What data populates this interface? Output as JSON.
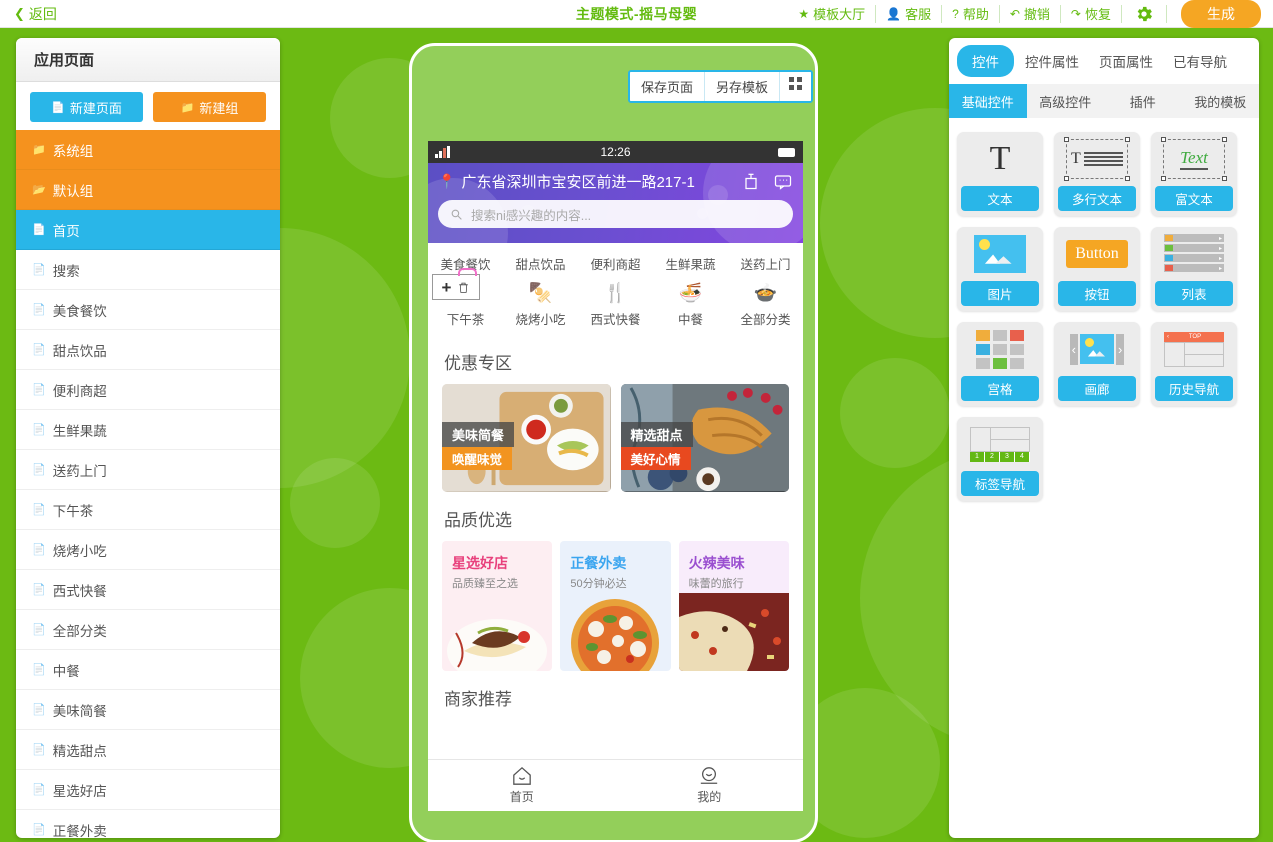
{
  "topbar": {
    "back_label": "返回",
    "title": "主题模式-摇马母婴",
    "items": [
      {
        "icon": "star-icon",
        "label": "模板大厅"
      },
      {
        "icon": "user-icon",
        "label": "客服"
      },
      {
        "icon": "question-icon",
        "label": "帮助"
      },
      {
        "icon": "undo-icon",
        "label": "撤销"
      },
      {
        "icon": "redo-icon",
        "label": "恢复"
      }
    ],
    "gear_icon": "gear-icon",
    "generate_label": "生成"
  },
  "pages_panel": {
    "header": "应用页面",
    "new_page_label": "新建页面",
    "new_group_label": "新建组",
    "rows": [
      {
        "label": "系统组",
        "type": "group",
        "icon": "folder-icon"
      },
      {
        "label": "默认组",
        "type": "group",
        "icon": "folder-open-icon"
      },
      {
        "label": "首页",
        "type": "page",
        "icon": "page-icon",
        "selected": true
      },
      {
        "label": "搜索",
        "type": "page",
        "icon": "page-icon"
      },
      {
        "label": "美食餐饮",
        "type": "page",
        "icon": "page-icon"
      },
      {
        "label": "甜点饮品",
        "type": "page",
        "icon": "page-icon"
      },
      {
        "label": "便利商超",
        "type": "page",
        "icon": "page-icon"
      },
      {
        "label": "生鲜果蔬",
        "type": "page",
        "icon": "page-icon"
      },
      {
        "label": "送药上门",
        "type": "page",
        "icon": "page-icon"
      },
      {
        "label": "下午茶",
        "type": "page",
        "icon": "page-icon"
      },
      {
        "label": "烧烤小吃",
        "type": "page",
        "icon": "page-icon"
      },
      {
        "label": "西式快餐",
        "type": "page",
        "icon": "page-icon"
      },
      {
        "label": "全部分类",
        "type": "page",
        "icon": "page-icon"
      },
      {
        "label": "中餐",
        "type": "page",
        "icon": "page-icon"
      },
      {
        "label": "美味简餐",
        "type": "page",
        "icon": "page-icon"
      },
      {
        "label": "精选甜点",
        "type": "page",
        "icon": "page-icon"
      },
      {
        "label": "星选好店",
        "type": "page",
        "icon": "page-icon"
      },
      {
        "label": "正餐外卖",
        "type": "page",
        "icon": "page-icon"
      }
    ]
  },
  "editor": {
    "save_page_label": "保存页面",
    "save_template_label": "另存模板",
    "qr_icon": "qr-code-icon"
  },
  "phone": {
    "status": {
      "time": "12:26",
      "signal_icon": "signal-icon",
      "battery_icon": "battery-icon"
    },
    "address": "广东省深圳市宝安区前进一路217-1",
    "banner_icons": [
      "scan-icon",
      "message-icon"
    ],
    "search_placeholder": "搜索ni感兴趣的内容...",
    "categories_row1": [
      {
        "label": "美食餐饮"
      },
      {
        "label": "甜点饮品"
      },
      {
        "label": "便利商超"
      },
      {
        "label": "生鲜果蔬"
      },
      {
        "label": "送药上门"
      }
    ],
    "categories_row2": [
      {
        "label": "下午茶",
        "icon": "",
        "editing": true
      },
      {
        "label": "烧烤小吃",
        "icon": "🍢"
      },
      {
        "label": "西式快餐",
        "icon": "🍴"
      },
      {
        "label": "中餐",
        "icon": "🍜"
      },
      {
        "label": "全部分类",
        "icon": "🍲"
      }
    ],
    "edit_overlay": {
      "add_icon": "plus-icon",
      "delete_icon": "trash-icon"
    },
    "promo_section_title": "优惠专区",
    "promos": [
      {
        "title": "美味简餐",
        "sub": "唤醒味觉",
        "sub_color": "#f29420"
      },
      {
        "title": "精选甜点",
        "sub": "美好心情",
        "sub_color": "#e8491f"
      }
    ],
    "quality_section_title": "品质优选",
    "quality": [
      {
        "title": "星选好店",
        "sub": "品质臻至之选",
        "title_color": "#e8407c",
        "bg": "#fdeef2"
      },
      {
        "title": "正餐外卖",
        "sub": "50分钟必达",
        "title_color": "#3aa5ef",
        "bg": "#eaf1fb"
      },
      {
        "title": "火辣美味",
        "sub": "味蕾的旅行",
        "title_color": "#9a4fd0",
        "bg": "#f8ecfb"
      }
    ],
    "merchant_section_title": "商家推荐",
    "tabbar": [
      {
        "label": "首页",
        "icon": "home-icon"
      },
      {
        "label": "我的",
        "icon": "profile-icon"
      }
    ]
  },
  "widget_panel": {
    "tabs": [
      {
        "label": "控件",
        "active": true
      },
      {
        "label": "控件属性",
        "active": false
      },
      {
        "label": "页面属性",
        "active": false
      },
      {
        "label": "已有导航",
        "active": false
      }
    ],
    "subtabs": [
      {
        "label": "基础控件",
        "active": true
      },
      {
        "label": "高级控件",
        "active": false
      },
      {
        "label": "插件",
        "active": false
      },
      {
        "label": "我的模板",
        "active": false
      }
    ],
    "widgets": [
      {
        "label": "文本",
        "thumb": "text-glyph"
      },
      {
        "label": "多行文本",
        "thumb": "multiline-text"
      },
      {
        "label": "富文本",
        "thumb": "rich-text"
      },
      {
        "label": "图片",
        "thumb": "image"
      },
      {
        "label": "按钮",
        "thumb": "button",
        "button_caption": "Button"
      },
      {
        "label": "列表",
        "thumb": "list"
      },
      {
        "label": "宫格",
        "thumb": "grid"
      },
      {
        "label": "画廊",
        "thumb": "gallery"
      },
      {
        "label": "历史导航",
        "thumb": "history-nav",
        "nav_caption": "TOP"
      },
      {
        "label": "标签导航",
        "thumb": "tab-nav",
        "tab_numbers": [
          "1",
          "2",
          "3",
          "4"
        ]
      }
    ],
    "accent_color": "#29b6e8"
  }
}
